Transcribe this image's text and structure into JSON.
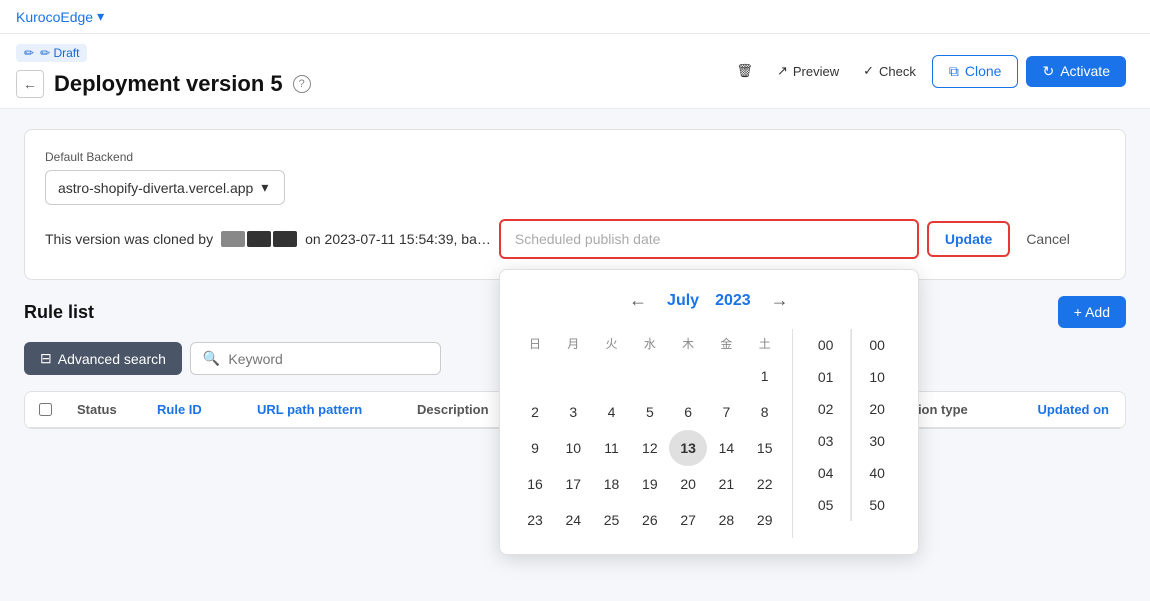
{
  "app": {
    "name": "KurocoEdge",
    "chevron": "▾"
  },
  "header": {
    "draft_badge": "✏ Draft",
    "title": "Deployment version 5",
    "help_icon": "?",
    "back_icon": "←",
    "delete_icon": "🗑",
    "preview_label": "Preview",
    "check_label": "Check",
    "clone_label": "Clone",
    "activate_label": "Activate"
  },
  "backend": {
    "label": "Default Backend",
    "value": "astro-shopify-diverta.vercel.app",
    "arrow": "▾"
  },
  "clone_info": {
    "prefix": "This version was cloned by",
    "suffix": "on 2023-07-11 15:54:39, ba…"
  },
  "scheduled": {
    "placeholder": "Scheduled publish date",
    "update_label": "Update",
    "cancel_label": "Cancel"
  },
  "calendar": {
    "prev": "←",
    "next": "→",
    "month": "July",
    "year": "2023",
    "days_of_week": [
      "日",
      "月",
      "火",
      "水",
      "木",
      "金",
      "土"
    ],
    "weeks": [
      [
        "",
        "",
        "",
        "",
        "",
        "",
        "1"
      ],
      [
        "2",
        "3",
        "4",
        "5",
        "6",
        "7",
        "8"
      ],
      [
        "9",
        "10",
        "11",
        "12",
        "13",
        "14",
        "15"
      ],
      [
        "16",
        "17",
        "18",
        "19",
        "20",
        "21",
        "22"
      ],
      [
        "23",
        "24",
        "25",
        "26",
        "27",
        "28",
        "29"
      ]
    ],
    "today": "13"
  },
  "time_picker": {
    "hours": [
      "00",
      "01",
      "02",
      "03",
      "04",
      "05"
    ],
    "minutes": [
      "00",
      "10",
      "20",
      "30",
      "40",
      "50"
    ]
  },
  "rule_list": {
    "title": "Rule list",
    "add_label": "+ Add",
    "advanced_search_label": "Advanced search",
    "keyword_placeholder": "Keyword",
    "filter_icon": "⊟"
  },
  "table": {
    "columns": {
      "status": "Status",
      "rule_id": "Rule ID",
      "url_path_pattern": "URL path pattern",
      "description": "Description",
      "action_type": "Action type",
      "updated_on": "Updated on"
    }
  }
}
